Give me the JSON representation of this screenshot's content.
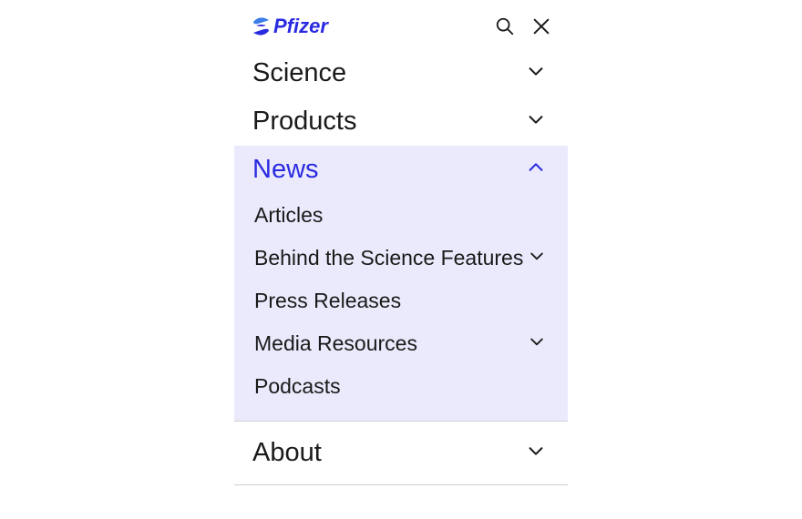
{
  "brand": {
    "name": "Pfizer",
    "logo_color_primary": "#2a2ae0",
    "logo_color_secondary": "#3a7de8"
  },
  "nav": {
    "items": [
      {
        "label": "Science",
        "expanded": false,
        "has_children": true
      },
      {
        "label": "Products",
        "expanded": false,
        "has_children": true
      },
      {
        "label": "News",
        "expanded": true,
        "has_children": true,
        "children": [
          {
            "label": "Articles",
            "has_children": false
          },
          {
            "label": "Behind the Science Features",
            "has_children": true
          },
          {
            "label": "Press Releases",
            "has_children": false
          },
          {
            "label": "Media Resources",
            "has_children": true
          },
          {
            "label": "Podcasts",
            "has_children": false
          }
        ]
      },
      {
        "label": "About",
        "expanded": false,
        "has_children": true
      }
    ]
  },
  "colors": {
    "expanded_bg": "#eaeafc",
    "expanded_text": "#2a2ae0",
    "text": "#1a1a1a",
    "divider": "#d0d0d0"
  }
}
